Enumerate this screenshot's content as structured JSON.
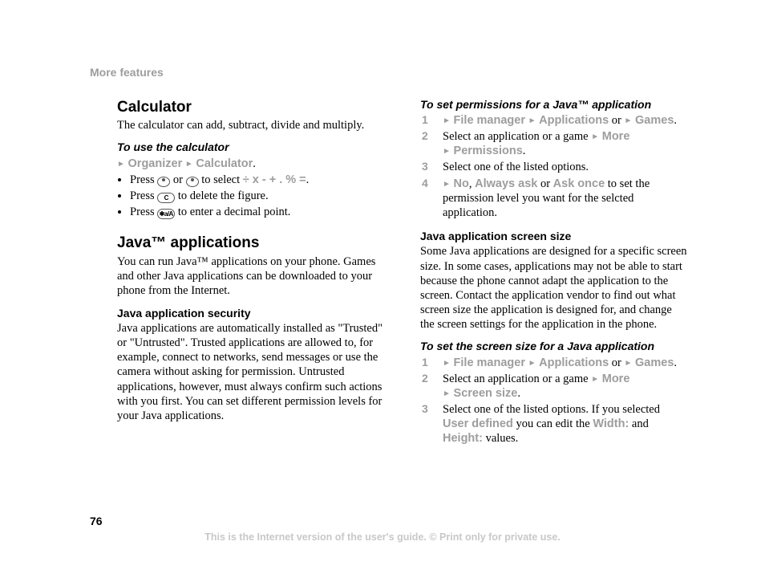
{
  "header": "More features",
  "page_number": "76",
  "footer": "This is the Internet version of the user's guide. © Print only for private use.",
  "left": {
    "calc_title": "Calculator",
    "calc_body": "The calculator can add, subtract, divide and multiply.",
    "calc_howto_title": "To use the calculator",
    "calc_nav1": "Organizer",
    "calc_nav2": "Calculator",
    "calc_b1a": "Press ",
    "calc_b1b": " or ",
    "calc_b1c": " to select ",
    "calc_ops": "÷ x - + . % =",
    "calc_b2a": "Press ",
    "calc_b2b": " to delete the figure.",
    "calc_b3a": "Press ",
    "calc_b3b": " to enter a decimal point.",
    "java_title": "Java™ applications",
    "java_body": "You can run Java™ applications on your phone. Games and other Java applications can be downloaded to your phone from the Internet.",
    "jsec_title": "Java application security",
    "jsec_body": "Java applications are automatically installed as \"Trusted\" or \"Untrusted\". Trusted applications are allowed to, for example, connect to networks, send messages or use the camera without asking for permission. Untrusted applications, however, must always confirm such actions with you first. You can set different permission levels for your Java applications."
  },
  "right": {
    "perm_title": "To set permissions for a Java™ application",
    "nav_filemgr": "File manager",
    "nav_apps": "Applications",
    "nav_or": " or ",
    "nav_games": "Games",
    "s2a": "Select an application or a game ",
    "nav_more": "More",
    "nav_perm": "Permissions",
    "s3": "Select one of the listed options.",
    "s4_no": "No",
    "s4_always": "Always ask",
    "s4_or": " or ",
    "s4_once": "Ask once",
    "s4_tail": " to set the permission level you want for the selcted application.",
    "size_title": "Java application screen size",
    "size_body": "Some Java applications are designed for a specific screen size. In some cases, applications may not be able to start because the phone cannot adapt the application to the screen. Contact the application vendor to find out what screen size the application is designed for, and change the screen settings for the application in the phone.",
    "size_howto_title": "To set the screen size for a Java application",
    "nav_screensize": "Screen size",
    "ss3a": "Select one of the listed options. If you selected ",
    "ss3_userdef": "User defined",
    "ss3b": " you can edit the ",
    "ss3_width": "Width:",
    "ss3c": " and ",
    "ss3_height": "Height:",
    "ss3d": " values."
  }
}
